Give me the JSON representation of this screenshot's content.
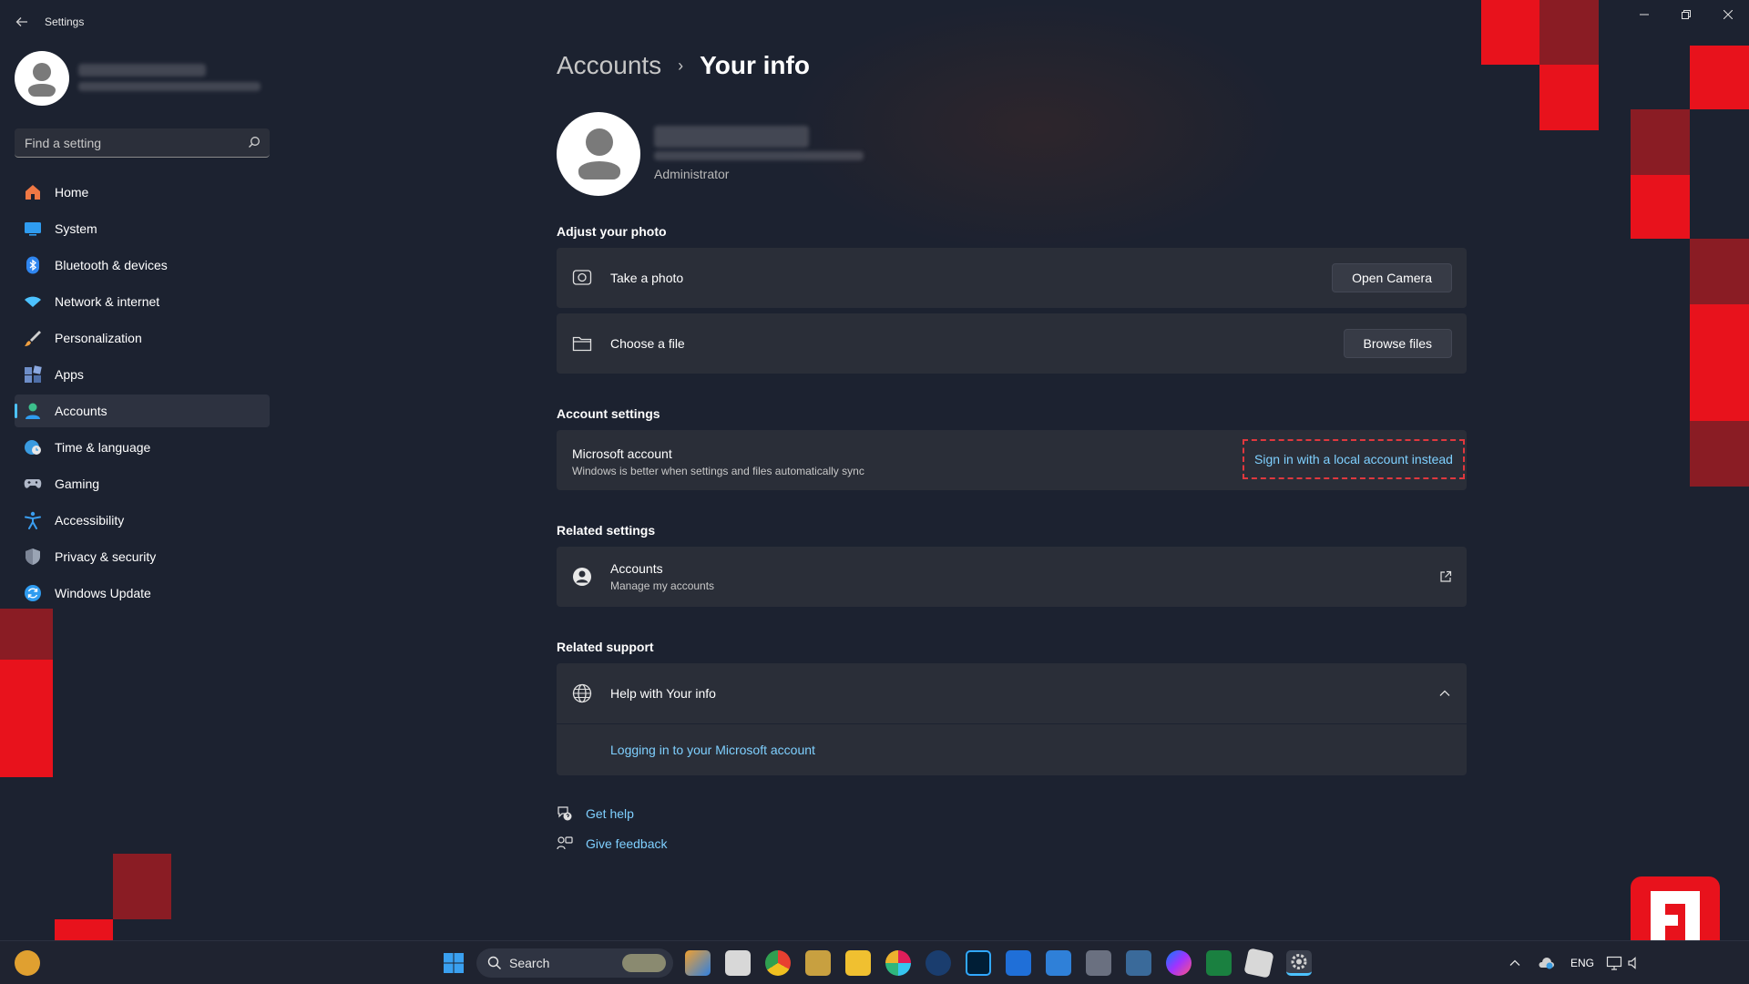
{
  "window": {
    "title": "Settings",
    "back_icon": "arrow-left-icon",
    "controls": [
      "minimize-icon",
      "restore-icon",
      "close-icon"
    ]
  },
  "sidebar": {
    "search": {
      "placeholder": "Find a setting"
    },
    "items": [
      {
        "label": "Home",
        "icon": "home-icon",
        "color": "#f07844"
      },
      {
        "label": "System",
        "icon": "monitor-icon",
        "color": "#2f9cf0"
      },
      {
        "label": "Bluetooth & devices",
        "icon": "bluetooth-icon",
        "color": "#2f86f0"
      },
      {
        "label": "Network & internet",
        "icon": "wifi-icon",
        "color": "#4cc2ff"
      },
      {
        "label": "Personalization",
        "icon": "brush-icon",
        "color": "#f0a040"
      },
      {
        "label": "Apps",
        "icon": "apps-icon",
        "color": "#6e8ec8"
      },
      {
        "label": "Accounts",
        "icon": "person-icon",
        "color": "#3cbf8c",
        "active": true
      },
      {
        "label": "Time & language",
        "icon": "globe-clock-icon",
        "color": "#3a9be0"
      },
      {
        "label": "Gaming",
        "icon": "gamepad-icon",
        "color": "#b0b8c8"
      },
      {
        "label": "Accessibility",
        "icon": "accessibility-icon",
        "color": "#3a9ef0"
      },
      {
        "label": "Privacy & security",
        "icon": "shield-icon",
        "color": "#9aa4b4"
      },
      {
        "label": "Windows Update",
        "icon": "sync-icon",
        "color": "#2f9cf0"
      }
    ]
  },
  "main": {
    "breadcrumb": {
      "parent": "Accounts",
      "separator": "›",
      "current": "Your info"
    },
    "user": {
      "role": "Administrator"
    },
    "adjust_photo": {
      "title": "Adjust your photo",
      "take_photo": {
        "label": "Take a photo",
        "button": "Open Camera"
      },
      "choose_file": {
        "label": "Choose a file",
        "button": "Browse files"
      }
    },
    "account_settings": {
      "title": "Account settings",
      "microsoft_account": {
        "label": "Microsoft account",
        "description": "Windows is better when settings and files automatically sync",
        "action": "Sign in with a local account instead"
      }
    },
    "related_settings": {
      "title": "Related settings",
      "accounts": {
        "label": "Accounts",
        "description": "Manage my accounts"
      }
    },
    "related_support": {
      "title": "Related support",
      "help": {
        "label": "Help with Your info",
        "link": "Logging in to your Microsoft account"
      }
    },
    "footer": {
      "get_help": "Get help",
      "give_feedback": "Give feedback"
    }
  },
  "taskbar": {
    "search_label": "Search",
    "tray": {
      "language": "ENG"
    }
  },
  "colors": {
    "accent": "#4cc2ff",
    "link": "#7fd0ff",
    "highlight_dash": "#e0383e",
    "brand_red": "#e8121c"
  }
}
